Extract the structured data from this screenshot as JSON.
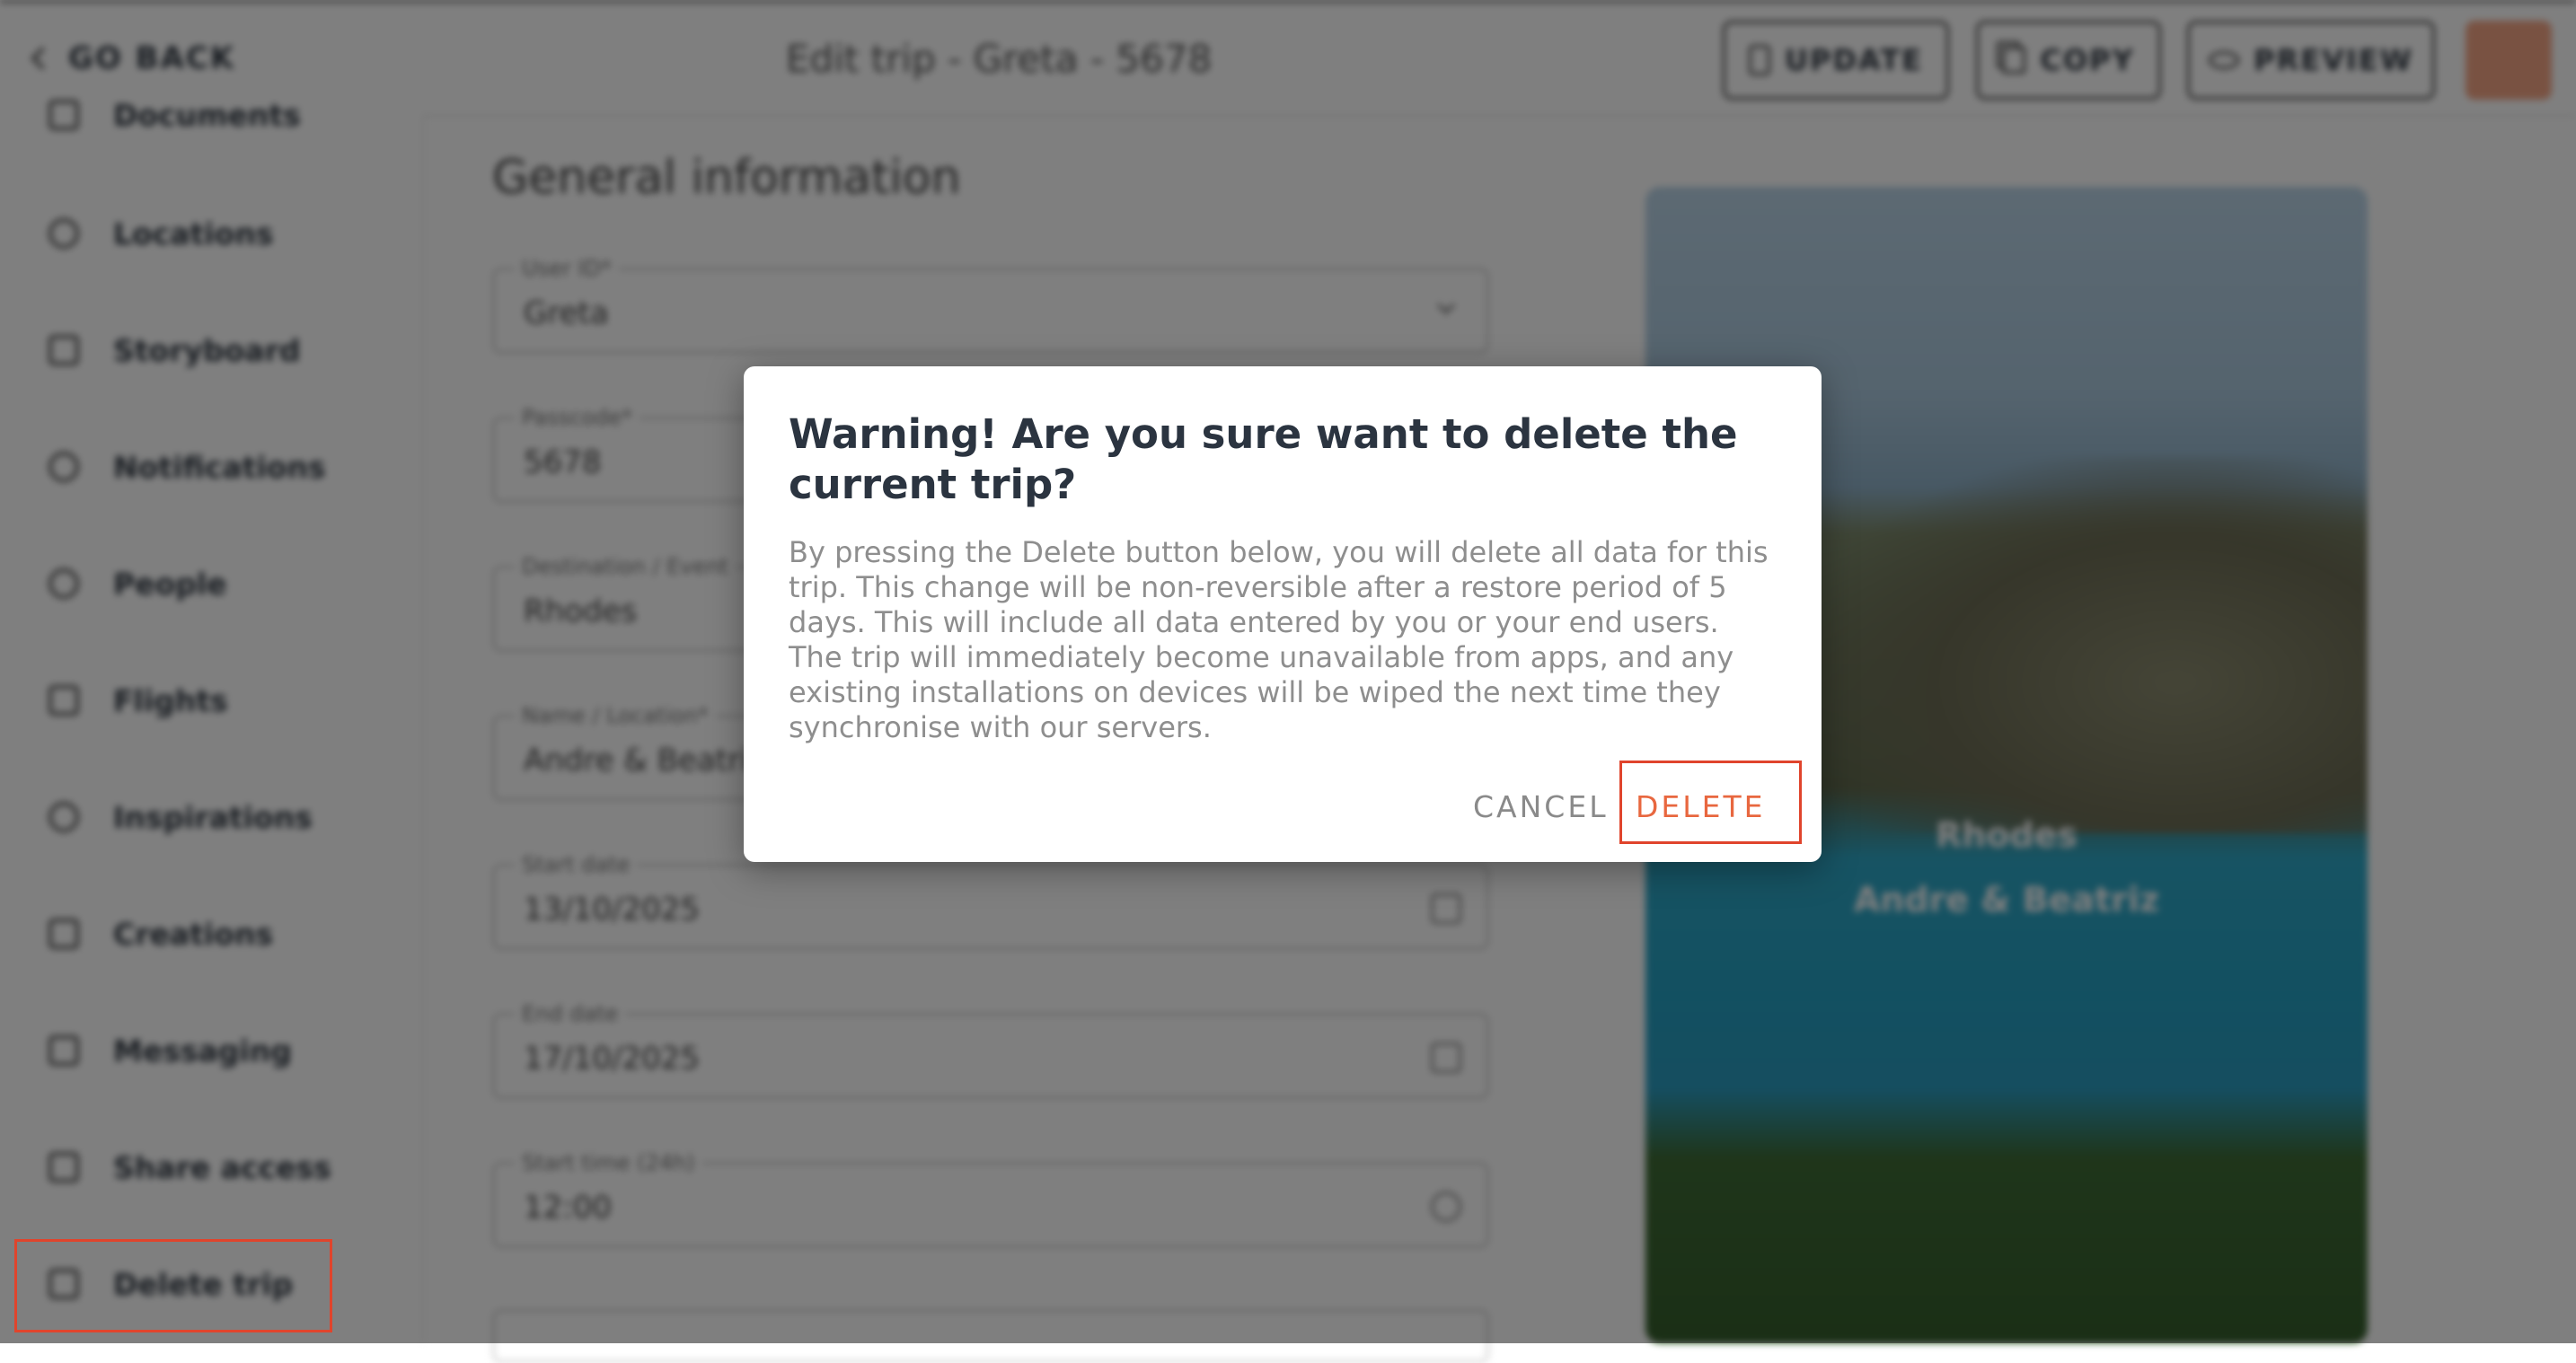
{
  "header": {
    "go_back": "GO BACK",
    "title": "Edit trip - Greta - 5678",
    "update": "UPDATE",
    "copy": "COPY",
    "preview": "PREVIEW"
  },
  "sidebar": {
    "items": [
      {
        "label": "Documents",
        "icon": "document-icon"
      },
      {
        "label": "Locations",
        "icon": "location-pin-icon"
      },
      {
        "label": "Storyboard",
        "icon": "storyboard-icon"
      },
      {
        "label": "Notifications",
        "icon": "bell-icon"
      },
      {
        "label": "People",
        "icon": "people-icon"
      },
      {
        "label": "Flights",
        "icon": "plane-icon"
      },
      {
        "label": "Inspirations",
        "icon": "globe-icon"
      },
      {
        "label": "Creations",
        "icon": "download-icon"
      },
      {
        "label": "Messaging",
        "icon": "envelope-icon"
      },
      {
        "label": "Share access",
        "icon": "lock-icon"
      },
      {
        "label": "Delete trip",
        "icon": "trash-icon"
      }
    ]
  },
  "main": {
    "section_title": "General information",
    "fields": [
      {
        "label": "User ID*",
        "value": "Greta"
      },
      {
        "label": "Passcode*",
        "value": "5678"
      },
      {
        "label": "Destination / Event",
        "value": "Rhodes"
      },
      {
        "label": "Name / Location*",
        "value": "Andre & Beatriz"
      },
      {
        "label": "Start date",
        "value": "13/10/2025"
      },
      {
        "label": "End date",
        "value": "17/10/2025"
      },
      {
        "label": "Start time (24h)",
        "value": "12:00"
      }
    ]
  },
  "preview_card": {
    "destination": "Rhodes",
    "names": "Andre & Beatriz"
  },
  "dialog": {
    "title": "Warning! Are you sure want to delete the current trip?",
    "body": "By pressing the Delete button below, you will delete all data for this trip. This change will be non-reversible after a restore period of 5 days. This will include all data entered by you or your end users. The trip will immediately become unavailable from apps, and any existing installations on devices will be wiped the next time they synchronise with our servers.",
    "cancel": "CANCEL",
    "delete": "DELETE"
  },
  "colors": {
    "accent": "#e8673f",
    "highlight": "#e0442c",
    "overlay": "rgba(0,0,0,0.5)"
  }
}
